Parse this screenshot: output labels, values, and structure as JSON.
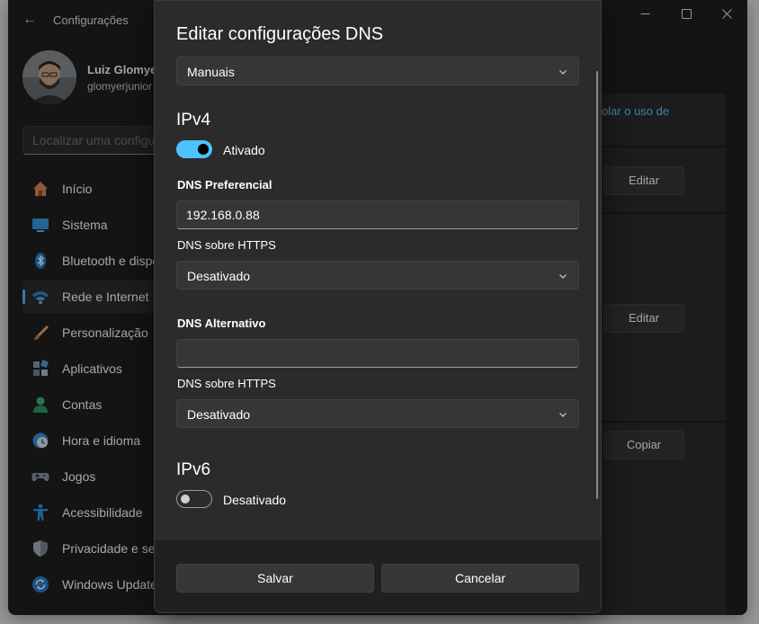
{
  "window": {
    "title": "Configurações",
    "back_icon": "back-arrow-icon"
  },
  "profile": {
    "name": "Luiz Glomye",
    "email": "glomyerjunior"
  },
  "search": {
    "placeholder": "Localizar uma configu"
  },
  "sidebar": {
    "items": [
      {
        "label": "Início",
        "icon": "home-icon",
        "active": false
      },
      {
        "label": "Sistema",
        "icon": "monitor-icon",
        "active": false
      },
      {
        "label": "Bluetooth e dispo",
        "icon": "bluetooth-icon",
        "active": false
      },
      {
        "label": "Rede e Internet",
        "icon": "wifi-icon",
        "active": true
      },
      {
        "label": "Personalização",
        "icon": "brush-icon",
        "active": false
      },
      {
        "label": "Aplicativos",
        "icon": "apps-icon",
        "active": false
      },
      {
        "label": "Contas",
        "icon": "person-icon",
        "active": false
      },
      {
        "label": "Hora e idioma",
        "icon": "clock-globe-icon",
        "active": false
      },
      {
        "label": "Jogos",
        "icon": "gamepad-icon",
        "active": false
      },
      {
        "label": "Acessibilidade",
        "icon": "accessibility-icon",
        "active": false
      },
      {
        "label": "Privacidade e seg",
        "icon": "shield-icon",
        "active": false
      },
      {
        "label": "Windows Update",
        "icon": "update-icon",
        "active": false
      }
    ]
  },
  "background_content": {
    "title_fragment": "t",
    "link_fragment": "trolar o uso de",
    "buttons": [
      "Editar",
      "Editar",
      "Copiar"
    ]
  },
  "dialog": {
    "title": "Editar configurações DNS",
    "mode_select": "Manuais",
    "ipv4": {
      "heading": "IPv4",
      "toggle_on": true,
      "toggle_label": "Ativado",
      "preferred_label": "DNS Preferencial",
      "preferred_value": "192.168.0.88",
      "preferred_https_label": "DNS sobre HTTPS",
      "preferred_https_value": "Desativado",
      "alternate_label": "DNS Alternativo",
      "alternate_value": "",
      "alternate_https_label": "DNS sobre HTTPS",
      "alternate_https_value": "Desativado"
    },
    "ipv6": {
      "heading": "IPv6",
      "toggle_on": false,
      "toggle_label": "Desativado"
    },
    "save_label": "Salvar",
    "cancel_label": "Cancelar"
  },
  "colors": {
    "accent": "#4cc2ff",
    "link": "#60cdff",
    "window_bg": "#202020",
    "dialog_bg": "#2b2b2b"
  }
}
